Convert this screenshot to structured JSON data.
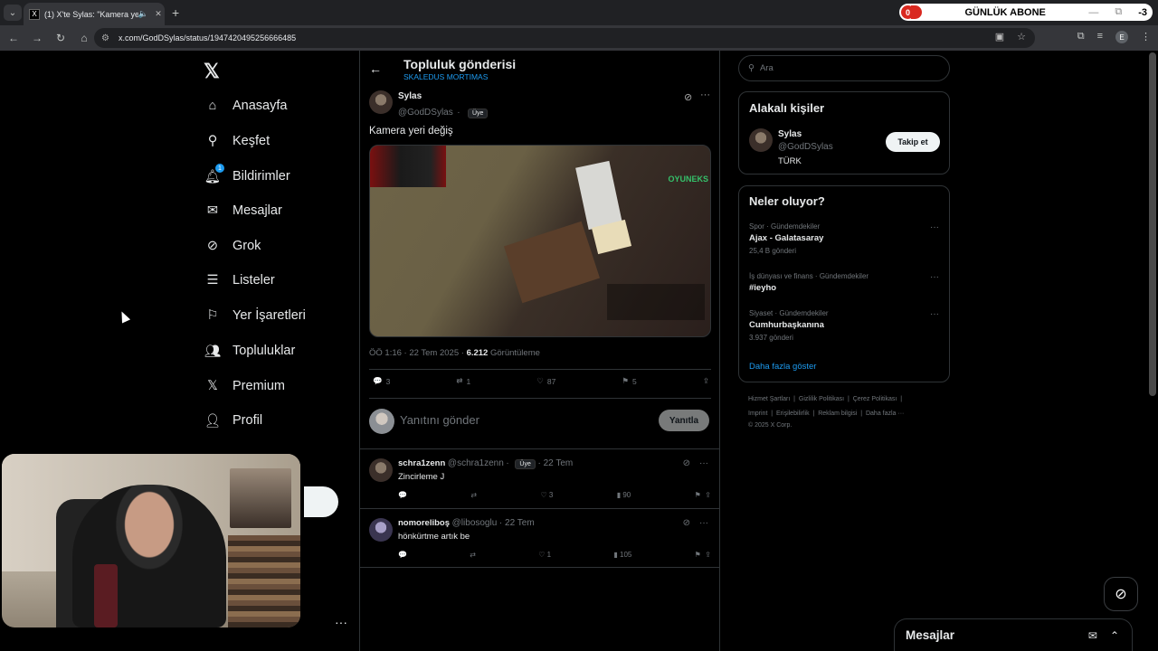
{
  "browser": {
    "tab_title": "(1) X'te Sylas: \"Kamera yeri",
    "tab_favicon": "X",
    "url": "x.com/GodDSylas/status/1947420495256666485",
    "profile_initial": "E",
    "overlay_counter": "0",
    "overlay_label": "GÜNLÜK ABONE",
    "overlay_right": "-3"
  },
  "sidebar": {
    "items": [
      {
        "label": "Anasayfa",
        "icon": "home-icon"
      },
      {
        "label": "Keşfet",
        "icon": "search-icon"
      },
      {
        "label": "Bildirimler",
        "icon": "bell-icon",
        "badge": "1"
      },
      {
        "label": "Mesajlar",
        "icon": "mail-icon"
      },
      {
        "label": "Grok",
        "icon": "grok-icon"
      },
      {
        "label": "Listeler",
        "icon": "list-icon"
      },
      {
        "label": "Yer İşaretleri",
        "icon": "bookmark-icon"
      },
      {
        "label": "Topluluklar",
        "icon": "communities-icon"
      },
      {
        "label": "Premium",
        "icon": "x-logo-icon"
      },
      {
        "label": "Profil",
        "icon": "person-icon"
      }
    ]
  },
  "header": {
    "title": "Topluluk gönderisi",
    "community": "SKALEDUS MORTIMAS"
  },
  "post": {
    "author_name": "Sylas",
    "author_handle": "@GodDSylas",
    "badge": "Üye",
    "text": "Kamera yeri değiş",
    "media_watermark": "OYUNEKS",
    "time": "ÖÖ 1:16 · 22 Tem 2025 · ",
    "views": "6.212",
    "views_label": " Görüntüleme",
    "replies": "3",
    "reposts": "1",
    "likes": "87",
    "bookmarks": "5"
  },
  "reply_box": {
    "placeholder": "Yanıtını gönder",
    "button": "Yanıtla"
  },
  "replies": [
    {
      "name": "schra1zenn",
      "handle": "@schra1zenn",
      "badge": "Üye",
      "date": "22 Tem",
      "text": "Zincirleme J",
      "likes": "3",
      "views": "90"
    },
    {
      "name": "nomoreliboş",
      "handle": "@libosoglu",
      "date": "22 Tem",
      "text": "hönkürtme artık be",
      "likes": "1",
      "views": "105"
    }
  ],
  "right": {
    "search_placeholder": "Ara",
    "related_title": "Alakalı kişiler",
    "related": {
      "name": "Sylas",
      "handle": "@GodDSylas",
      "bio": "TÜRK",
      "follow": "Takip et"
    },
    "trends_title": "Neler oluyor?",
    "trends": [
      {
        "category": "Spor · Gündemdekiler",
        "name": "Ajax - Galatasaray",
        "count": "25,4 B gönderi"
      },
      {
        "category": "İş dünyası ve finans · Gündemdekiler",
        "name": "#ieyho",
        "count": ""
      },
      {
        "category": "Siyaset · Gündemdekiler",
        "name": "Cumhurbaşkanına",
        "count": "3.937 gönderi"
      }
    ],
    "show_more": "Daha fazla göster",
    "footer_row1": [
      "Hizmet Şartları",
      "Gizlilik Politikası",
      "Çerez Politikası"
    ],
    "footer_row2": [
      "Imprint",
      "Erişilebilirlik",
      "Reklam bilgisi",
      "Daha fazla ···"
    ],
    "copyright": "© 2025 X Corp."
  },
  "messages_drawer": {
    "title": "Mesajlar"
  }
}
